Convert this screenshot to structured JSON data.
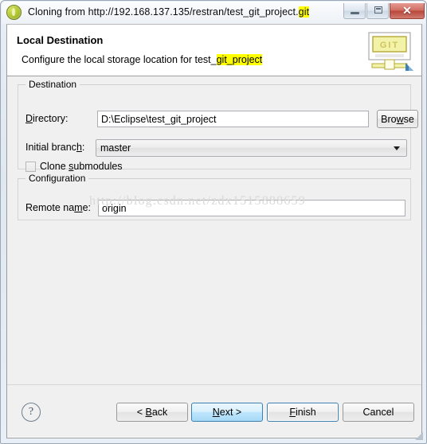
{
  "window": {
    "title_prefix": "Cloning from http://192.168.137.135/restran/test_git_project.",
    "title_highlight": "git",
    "app_icon": "egit-circle-icon",
    "controls": {
      "minimize": "minimize-icon",
      "maximize": "maximize-icon",
      "close": "✕"
    }
  },
  "page_header": {
    "title": "Local Destination",
    "description_prefix": "Configure the local storage location for test_",
    "description_highlight": "git_project",
    "banner_icon": "git-banner-icon",
    "banner_text": "GIT"
  },
  "destination_group": {
    "legend": "Destination",
    "directory": {
      "label_pre": "D",
      "label_accel": "",
      "label_full": "Directory:",
      "label_before": "",
      "label_underlined": "D",
      "label_after": "irectory:",
      "value": "D:\\Eclipse\\test_git_project",
      "browse_before": "Bro",
      "browse_underlined": "w",
      "browse_after": "se",
      "browse_label": "Browse"
    },
    "initial_branch": {
      "label_before": "Initial branc",
      "label_underlined": "h",
      "label_after": ":",
      "label_full": "Initial branch:",
      "selected": "master",
      "options": [
        "master"
      ]
    },
    "clone_submodules": {
      "label_before": "Clone ",
      "label_underlined": "s",
      "label_after": "ubmodules",
      "label_full": "Clone submodules",
      "checked": false
    }
  },
  "configuration_group": {
    "legend": "Configuration",
    "remote_name": {
      "label_before": "Remote na",
      "label_underlined": "m",
      "label_after": "e:",
      "label_full": "Remote name:",
      "value": "origin"
    }
  },
  "watermark": {
    "text": "http://blog.csdn.net/zdx1515888659"
  },
  "footer": {
    "help_icon": "?",
    "back": {
      "before": "< ",
      "underlined": "B",
      "after": "ack",
      "full": "< Back"
    },
    "next": {
      "before": "",
      "underlined": "N",
      "after": "ext >",
      "full": "Next >"
    },
    "finish": {
      "before": "",
      "underlined": "F",
      "after": "inish",
      "full": "Finish"
    },
    "cancel": {
      "before": "",
      "underlined": "",
      "after": "Cancel",
      "full": "Cancel"
    }
  },
  "colors": {
    "highlight_yellow": "#ffff00",
    "default_button_border": "#3c7fb1",
    "hover_button_fill": "#bee6fd",
    "close_button_red": "#b8463a"
  }
}
